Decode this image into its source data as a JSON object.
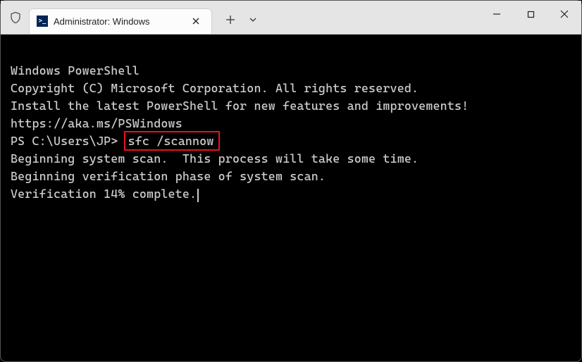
{
  "titlebar": {
    "tab_title": "Administrator: Windows",
    "powershell_glyph": ">_"
  },
  "terminal": {
    "line1": "Windows PowerShell",
    "line2": "Copyright (C) Microsoft Corporation. All rights reserved.",
    "line3": "Install the latest PowerShell for new features and improvements!",
    "line4": "https://aka.ms/PSWindows",
    "prompt": "PS C:\\Users\\JP> ",
    "command": "sfc /scannow",
    "line5": "Beginning system scan.  This process will take some time.",
    "line6": "Beginning verification phase of system scan.",
    "line7": "Verification 14% complete."
  }
}
